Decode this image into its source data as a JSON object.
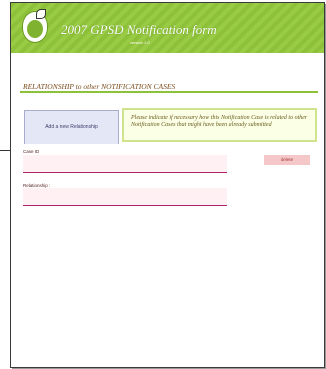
{
  "header": {
    "title": "2007 GPSD Notification form",
    "version": "version 1.0"
  },
  "section": {
    "title": "RELATIONSHIP to other NOTIFICATION CASES"
  },
  "actions": {
    "add_label": "Add a new Relationship",
    "delete_label": "delete"
  },
  "note": {
    "text": "Please indicate if necessary how this Notification Case is related to other Notification Cases that might have been already submitted"
  },
  "form": {
    "case_id_label": "Case ID",
    "case_id_value": "",
    "relationship_label": "Relationship :",
    "relationship_value": ""
  },
  "colors": {
    "header_green": "#8ec13a",
    "field_pink": "#fff1f3",
    "field_underline": "#b0226a",
    "delete_pink": "#f6c7c9",
    "note_border": "#cfe38c"
  }
}
